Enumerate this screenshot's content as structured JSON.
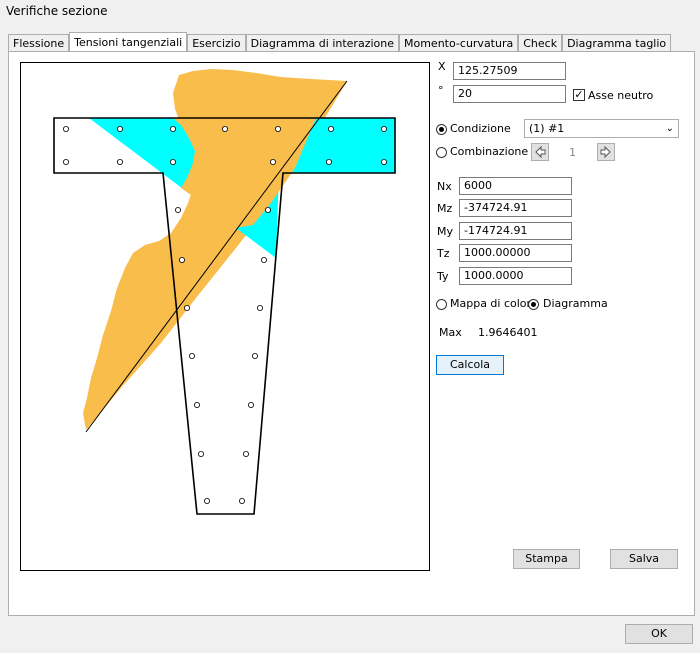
{
  "window": {
    "title": "Verifiche sezione"
  },
  "tabs": [
    {
      "label": "Flessione"
    },
    {
      "label": "Tensioni tangenziali"
    },
    {
      "label": "Esercizio"
    },
    {
      "label": "Diagramma di interazione"
    },
    {
      "label": "Momento-curvatura"
    },
    {
      "label": "Check"
    },
    {
      "label": "Diagramma taglio"
    }
  ],
  "controls": {
    "x_label": "X",
    "x_value": "125.27509",
    "deg_label": "°",
    "deg_value": "20",
    "asse_neutro_label": "Asse neutro",
    "asse_neutro_checked": true,
    "condizione_label": "Condizione",
    "condizione_value": "(1) #1",
    "combinazione_label": "Combinazione",
    "comb_index": "1",
    "nx_label": "Nx",
    "nx_value": "6000",
    "mz_label": "Mz",
    "mz_value": "-374724.91",
    "my_label": "My",
    "my_value": "-174724.91",
    "tz_label": "Tz",
    "tz_value": "1000.00000",
    "ty_label": "Ty",
    "ty_value": "1000.0000",
    "mappa_label": "Mappa di colori",
    "diagramma_label": "Diagramma",
    "max_label": "Max",
    "max_value": "1.9646401",
    "calcola_label": "Calcola",
    "stampa_label": "Stampa",
    "salva_label": "Salva",
    "ok_label": "OK"
  },
  "colors": {
    "compressed_area": "#00ffff",
    "stress_diagram": "#f9bd4c",
    "outline": "#000000"
  }
}
